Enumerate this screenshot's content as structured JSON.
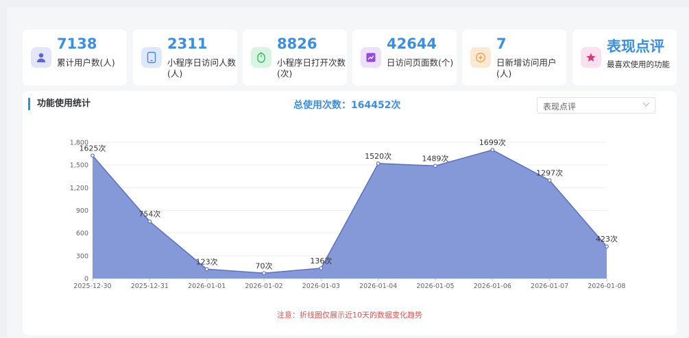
{
  "stats": [
    {
      "value": "7138",
      "label": "累计用户数(人)",
      "icon": "user-icon",
      "bg": "#e3e6fb",
      "fg": "#5a63d8"
    },
    {
      "value": "2311",
      "label": "小程序日访问人数(人)",
      "icon": "tablet-icon",
      "bg": "#dde9fb",
      "fg": "#4a84d6"
    },
    {
      "value": "8826",
      "label": "小程序日打开次数(次)",
      "icon": "mouse-icon",
      "bg": "#d9f4e3",
      "fg": "#36b566"
    },
    {
      "value": "42644",
      "label": "日访问页面数(个)",
      "icon": "chart-icon",
      "bg": "#ece0fb",
      "fg": "#9346e0"
    },
    {
      "value": "7",
      "label": "日新增访问用户(人)",
      "icon": "plus-circle-icon",
      "bg": "#fbe9d4",
      "fg": "#ea9a3c"
    },
    {
      "value": "表现点评",
      "label": "最喜欢使用的功能",
      "icon": "star-icon",
      "bg": "#fbe1ef",
      "fg": "#d9367c"
    }
  ],
  "panel": {
    "title": "功能使用统计",
    "total": "总使用次数：164452次",
    "select_value": "表现点评",
    "note": "注意：折线图仅展示近10天的数据变化趋势"
  },
  "chart_data": {
    "type": "area",
    "x": [
      "2025-12-30",
      "2025-12-31",
      "2026-01-01",
      "2026-01-02",
      "2026-01-03",
      "2026-01-04",
      "2026-01-05",
      "2026-01-06",
      "2026-01-07",
      "2026-01-08"
    ],
    "values": [
      1625,
      754,
      123,
      70,
      136,
      1520,
      1489,
      1699,
      1297,
      423
    ],
    "data_labels": [
      "1625次",
      "754次",
      "123次",
      "70次",
      "136次",
      "1520次",
      "1489次",
      "1699次",
      "1297次",
      "423次"
    ],
    "y_ticks": [
      "0",
      "300",
      "600",
      "900",
      "1,200",
      "1,500",
      "1,800"
    ],
    "ylim": [
      0,
      1800
    ],
    "grid": true,
    "fill": "#8599d8",
    "line": "#5b6fc0"
  }
}
